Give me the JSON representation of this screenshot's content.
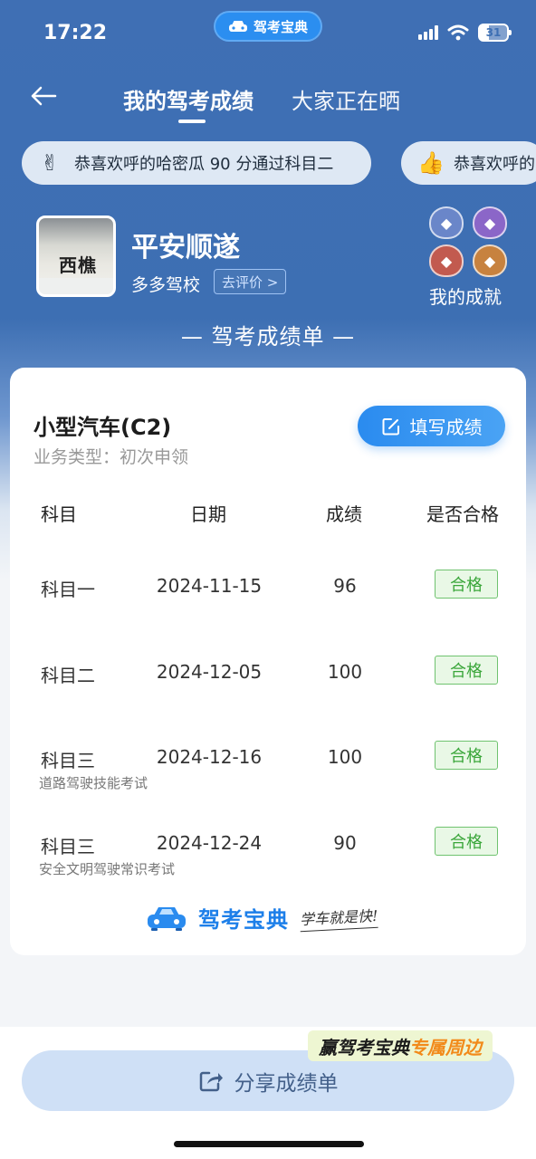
{
  "status_bar": {
    "time": "17:22",
    "app_pill": "驾考宝典",
    "battery": "31"
  },
  "nav": {
    "tabs": [
      "我的驾考成绩",
      "大家正在晒"
    ]
  },
  "congrats": [
    {
      "emoji": "✌",
      "text": "恭喜欢呼的哈密瓜 90 分通过科目二"
    },
    {
      "emoji": "👍",
      "text": "恭喜欢呼的"
    }
  ],
  "profile": {
    "avatar_text": "西樵",
    "name": "平安顺遂",
    "school": "多多驾校",
    "rate_label": "去评价 >",
    "achievements_label": "我的成就",
    "badge_colors": [
      "#6a86c9",
      "#8b66c8",
      "#c25a4f",
      "#c7823f"
    ]
  },
  "section_title": "— 驾考成绩单 —",
  "card": {
    "vehicle": "小型汽车(C2)",
    "business_type": "业务类型：初次申领",
    "fill_button": "填写成绩",
    "headers": [
      "科目",
      "日期",
      "成绩",
      "是否合格"
    ],
    "rows": [
      {
        "subject": "科目一",
        "note": "",
        "date": "2024-11-15",
        "score": "96",
        "result": "合格"
      },
      {
        "subject": "科目二",
        "note": "",
        "date": "2024-12-05",
        "score": "100",
        "result": "合格"
      },
      {
        "subject": "科目三",
        "note": "道路驾驶技能考试",
        "date": "2024-12-16",
        "score": "100",
        "result": "合格"
      },
      {
        "subject": "科目三",
        "note": "安全文明驾驶常识考试",
        "date": "2024-12-24",
        "score": "90",
        "result": "合格"
      }
    ],
    "brand": "驾考宝典",
    "slogan": "学车就是快!"
  },
  "promo": {
    "prefix": "赢驾考宝典",
    "highlight": "专属周边"
  },
  "share_button": "分享成绩单",
  "colors": {
    "primary_blue": "#3d6fb3",
    "accent_blue": "#2a8bef",
    "pass_green": "#3aa63a"
  }
}
